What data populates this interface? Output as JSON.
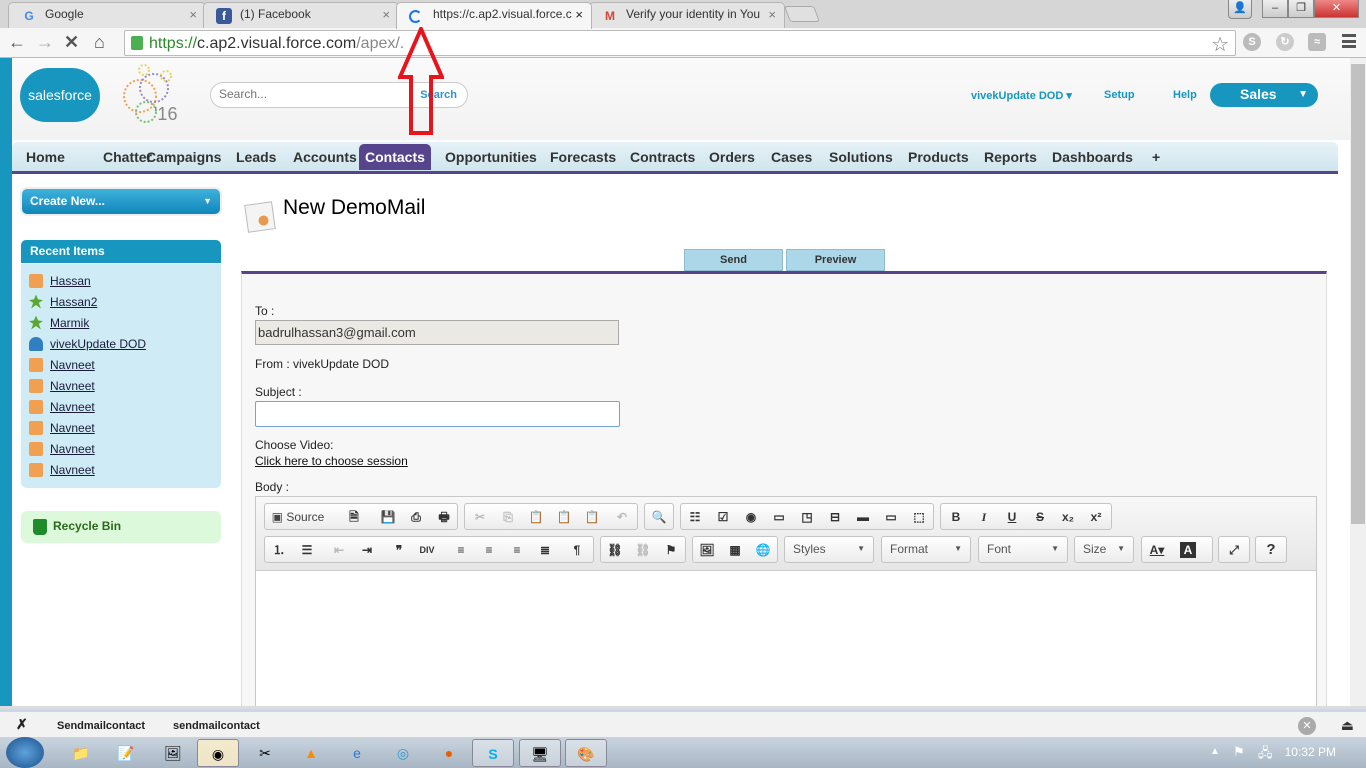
{
  "browser": {
    "tabs": [
      {
        "title": "Google",
        "icon": "google-icon",
        "icon_color": "#4285f4"
      },
      {
        "title": "(1) Facebook",
        "icon": "facebook-icon",
        "icon_color": "#3b5998"
      },
      {
        "title": "https://c.ap2.visual.force.c",
        "icon": "loading-spinner-icon",
        "icon_color": "#1a73e8",
        "active": true
      },
      {
        "title": "Verify your identity in You",
        "icon": "gmail-icon",
        "icon_color": "#d44638"
      }
    ],
    "close_glyph": "×",
    "url_scheme": "https://",
    "url_host": "c.ap2.visual.force.com",
    "url_path": "/apex/."
  },
  "header": {
    "logo_text": "salesforce",
    "logo_badge": "'16",
    "search_placeholder": "Search...",
    "search_button": "Search",
    "user_menu": "vivekUpdate DOD",
    "setup": "Setup",
    "help": "Help",
    "app": "Sales"
  },
  "nav_tabs": [
    "Home",
    "Chatter",
    "Campaigns",
    "Leads",
    "Accounts",
    "Contacts",
    "Opportunities",
    "Forecasts",
    "Contracts",
    "Orders",
    "Cases",
    "Solutions",
    "Products",
    "Reports",
    "Dashboards",
    "+"
  ],
  "active_tab": "Contacts",
  "sidebar": {
    "create_new": "Create New...",
    "recent_title": "Recent Items",
    "recent_items": [
      {
        "label": "Hassan",
        "icon": "contact-card-icon",
        "color": "#f0a050"
      },
      {
        "label": "Hassan2",
        "icon": "lead-icon",
        "color": "#5aa832"
      },
      {
        "label": "Marmik",
        "icon": "lead-icon",
        "color": "#5aa832"
      },
      {
        "label": "vivekUpdate DOD",
        "icon": "user-icon",
        "color": "#2f7fc1"
      },
      {
        "label": "Navneet",
        "icon": "folder-icon",
        "color": "#f0a050"
      },
      {
        "label": "Navneet",
        "icon": "folder-icon",
        "color": "#f0a050"
      },
      {
        "label": "Navneet",
        "icon": "folder-icon",
        "color": "#f0a050"
      },
      {
        "label": "Navneet",
        "icon": "folder-icon",
        "color": "#f0a050"
      },
      {
        "label": "Navneet",
        "icon": "folder-icon",
        "color": "#f0a050"
      },
      {
        "label": "Navneet",
        "icon": "folder-icon",
        "color": "#f0a050"
      }
    ],
    "recycle_bin": "Recycle Bin"
  },
  "main": {
    "title": "New DemoMail",
    "send": "Send",
    "preview": "Preview",
    "to_label": "To :",
    "to_value": "badrulhassan3@gmail.com",
    "from_text": "From : vivekUpdate DOD",
    "subject_label": "Subject :",
    "subject_value": "",
    "choose_video_label": "Choose Video:",
    "choose_video_link": "Click here to choose session",
    "body_label": "Body :"
  },
  "editor": {
    "source": "Source",
    "styles": "Styles",
    "format": "Format",
    "font": "Font",
    "size": "Size"
  },
  "download_bar": {
    "items": [
      "Sendmailcontact",
      "sendmailcontact"
    ]
  },
  "taskbar": {
    "clock": "10:32 PM"
  },
  "colors": {
    "brand": "#1797c0",
    "active_tab": "#56458c",
    "action_button": "#acd7e8"
  }
}
